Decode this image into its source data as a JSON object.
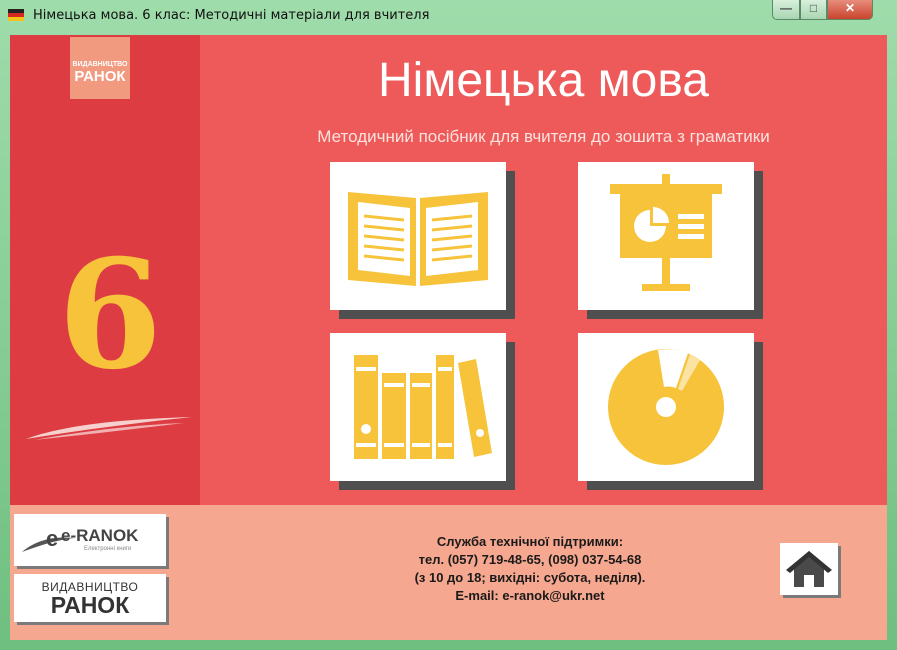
{
  "window": {
    "title": "Німецька мова. 6 клас: Методичні матеріали для вчителя",
    "controls": {
      "minimize": "—",
      "maximize": "□",
      "close": "✕"
    }
  },
  "header": {
    "publisher_badge_small": "ВИДАВНИЦТВО",
    "publisher_badge_big": "РАНОК",
    "title": "Німецька мова",
    "subtitle": "Методичний посібник для вчителя до зошита з граматики"
  },
  "grade": "6",
  "menu": {
    "items": [
      {
        "icon": "open-book-icon"
      },
      {
        "icon": "presentation-board-icon"
      },
      {
        "icon": "library-books-icon"
      },
      {
        "icon": "disc-icon"
      }
    ]
  },
  "footer": {
    "eranok_logo": "e-RANOK",
    "eranok_tagline": "Електронні книги",
    "ranok_logo_small": "ВИДАВНИЦТВО",
    "ranok_logo_big": "РАНОК",
    "support": {
      "line1": "Служба технічної підтримки:",
      "line2": "тел. (057) 719-48-65, (098) 037-54-68",
      "line3": "(з 10 до 18; вихідні: субота, неділя).",
      "line4": "E-mail: e-ranok@ukr.net"
    },
    "home_icon": "home-icon"
  },
  "colors": {
    "background": "#ee5a5a",
    "left_band": "#dd3d42",
    "accent": "#f6c33b",
    "footer": "#f6a78f",
    "titlebar": "#8fd09c"
  }
}
